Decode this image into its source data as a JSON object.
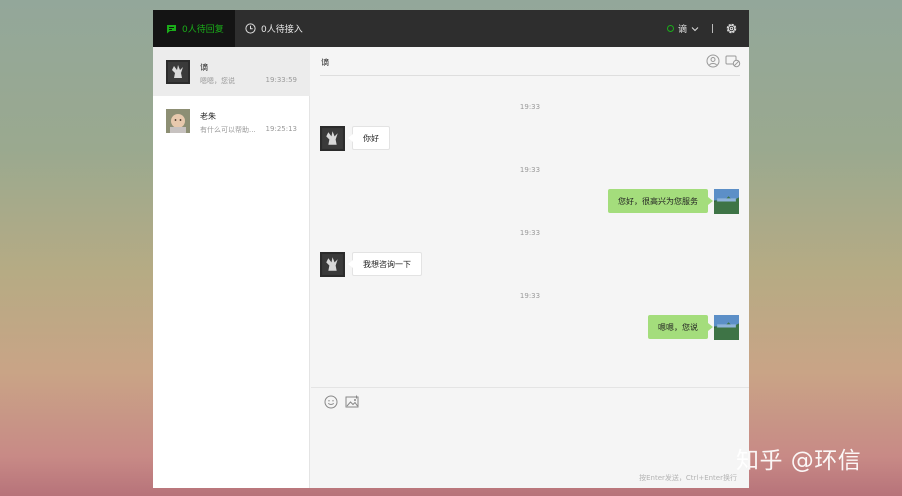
{
  "topbar": {
    "tab_pending_reply": "0人待回复",
    "tab_pending_accept": "0人待接入",
    "agent_name": "谪",
    "status_color": "#1aad19"
  },
  "conversations": [
    {
      "name": "谪",
      "preview": "嗯嗯，您说",
      "time": "19:33:59"
    },
    {
      "name": "老朱",
      "preview": "有什么可以帮助...",
      "time": "19:25:13"
    }
  ],
  "chat": {
    "title": "谪",
    "messages": [
      {
        "time": "19:33",
        "side": "left",
        "text": "你好"
      },
      {
        "time": "19:33",
        "side": "right",
        "text": "您好，很高兴为您服务"
      },
      {
        "time": "19:33",
        "side": "left",
        "text": "我想咨询一下"
      },
      {
        "time": "19:33",
        "side": "right",
        "text": "嗯嗯，您说"
      }
    ],
    "input_hint": "按Enter发送，Ctrl+Enter换行"
  },
  "icons": {
    "chat_tab": "chat-bubble-icon",
    "clock_tab": "clock-icon",
    "settings": "gear-icon",
    "transfer": "user-transfer-icon",
    "end_session": "end-session-icon",
    "emoji": "smiley-icon",
    "image": "image-icon"
  },
  "watermark": "知乎 @环信"
}
